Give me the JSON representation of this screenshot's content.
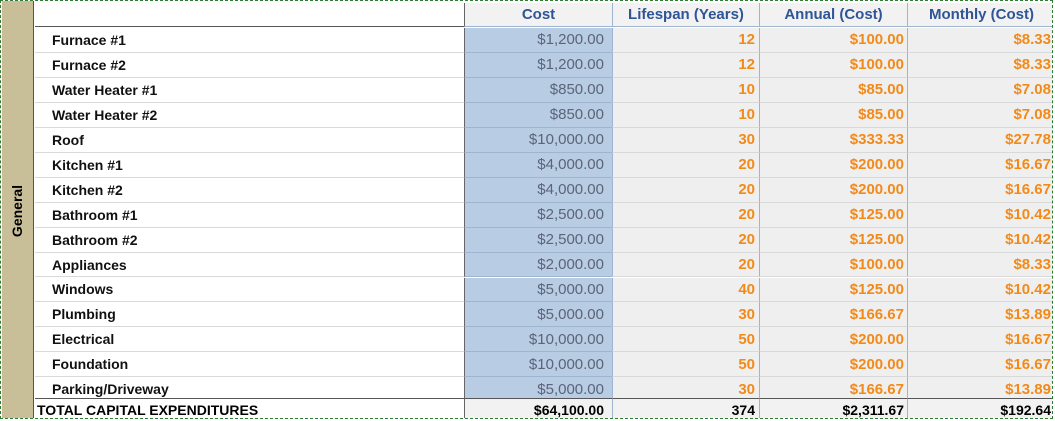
{
  "side_label": "General",
  "headers": {
    "cost": "Cost",
    "lifespan": "Lifespan (Years)",
    "annual": "Annual (Cost)",
    "monthly": "Monthly (Cost)"
  },
  "rows": [
    {
      "name": "Furnace #1",
      "cost": "$1,200.00",
      "lifespan": "12",
      "annual": "$100.00",
      "monthly": "$8.33"
    },
    {
      "name": "Furnace #2",
      "cost": "$1,200.00",
      "lifespan": "12",
      "annual": "$100.00",
      "monthly": "$8.33"
    },
    {
      "name": "Water Heater #1",
      "cost": "$850.00",
      "lifespan": "10",
      "annual": "$85.00",
      "monthly": "$7.08"
    },
    {
      "name": "Water Heater #2",
      "cost": "$850.00",
      "lifespan": "10",
      "annual": "$85.00",
      "monthly": "$7.08"
    },
    {
      "name": "Roof",
      "cost": "$10,000.00",
      "lifespan": "30",
      "annual": "$333.33",
      "monthly": "$27.78"
    },
    {
      "name": "Kitchen #1",
      "cost": "$4,000.00",
      "lifespan": "20",
      "annual": "$200.00",
      "monthly": "$16.67"
    },
    {
      "name": "Kitchen #2",
      "cost": "$4,000.00",
      "lifespan": "20",
      "annual": "$200.00",
      "monthly": "$16.67"
    },
    {
      "name": "Bathroom #1",
      "cost": "$2,500.00",
      "lifespan": "20",
      "annual": "$125.00",
      "monthly": "$10.42"
    },
    {
      "name": "Bathroom #2",
      "cost": "$2,500.00",
      "lifespan": "20",
      "annual": "$125.00",
      "monthly": "$10.42"
    },
    {
      "name": "Appliances",
      "cost": "$2,000.00",
      "lifespan": "20",
      "annual": "$100.00",
      "monthly": "$8.33"
    },
    {
      "name": "Windows",
      "cost": "$5,000.00",
      "lifespan": "40",
      "annual": "$125.00",
      "monthly": "$10.42"
    },
    {
      "name": "Plumbing",
      "cost": "$5,000.00",
      "lifespan": "30",
      "annual": "$166.67",
      "monthly": "$13.89"
    },
    {
      "name": "Electrical",
      "cost": "$10,000.00",
      "lifespan": "50",
      "annual": "$200.00",
      "monthly": "$16.67"
    },
    {
      "name": "Foundation",
      "cost": "$10,000.00",
      "lifespan": "50",
      "annual": "$200.00",
      "monthly": "$16.67"
    },
    {
      "name": "Parking/Driveway",
      "cost": "$5,000.00",
      "lifespan": "30",
      "annual": "$166.67",
      "monthly": "$13.89"
    }
  ],
  "total": {
    "label": "TOTAL CAPITAL EXPENDITURES",
    "cost": "$64,100.00",
    "lifespan": "374",
    "annual": "$2,311.67",
    "monthly": "$192.64"
  },
  "colors": {
    "input_fill": "#b8cce4",
    "calc_text": "#f28a1a",
    "header_text": "#2f5597",
    "side_band": "#c8bf99",
    "border_dashed": "#2e7d32"
  }
}
